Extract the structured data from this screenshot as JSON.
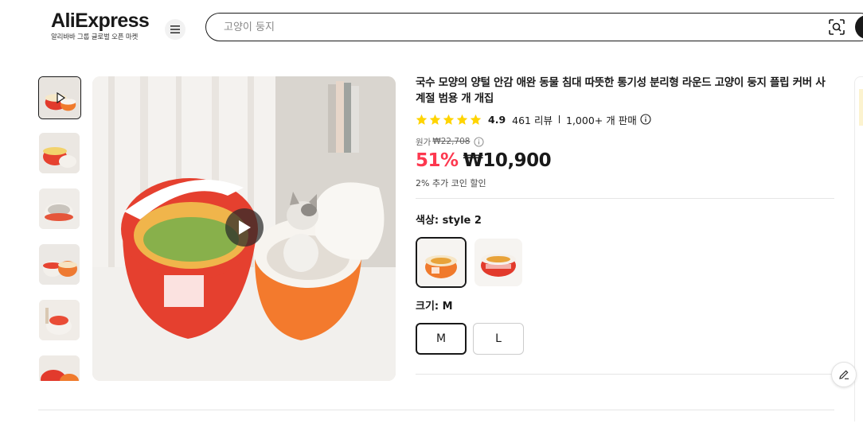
{
  "header": {
    "logo_text": "AliExpress",
    "logo_tagline": "알리바바 그룹 글로벌 오픈 마켓",
    "search_placeholder": "고양이 둥지",
    "icons": {
      "menu": "hamburger-menu-icon",
      "camera": "camera-search-icon",
      "search": "search-icon"
    }
  },
  "gallery": {
    "thumbnail_count": 6,
    "active_thumbnail": 1,
    "main_media": "video",
    "icons": {
      "play": "play-icon"
    }
  },
  "product": {
    "title": "국수 모양의 양털 안감 애완 동물 침대 따뜻한 통기성 분리형 라운드 고양이 둥지 플립 커버 사계절 범용 개 개집",
    "rating": "4.9",
    "rating_value": 4.9,
    "reviews": "461 리뷰",
    "sold": "1,000+ 개 판매",
    "original_label": "원가",
    "original_price": "₩22,708",
    "discount": "51%",
    "price": "₩10,900",
    "coin_discount": "2% 추가 코인 할인",
    "colors": {
      "accent_red": "#fd384f",
      "star": "#ffd400",
      "text": "#191919"
    }
  },
  "options": {
    "color_label": "색상: style 2",
    "color_swatches": [
      "style 2",
      "style 1"
    ],
    "selected_color": "style 2",
    "size_label": "크기: M",
    "sizes": [
      "M",
      "L"
    ],
    "selected_size": "M"
  },
  "floating": {
    "edit_icon": "pencil-icon"
  }
}
